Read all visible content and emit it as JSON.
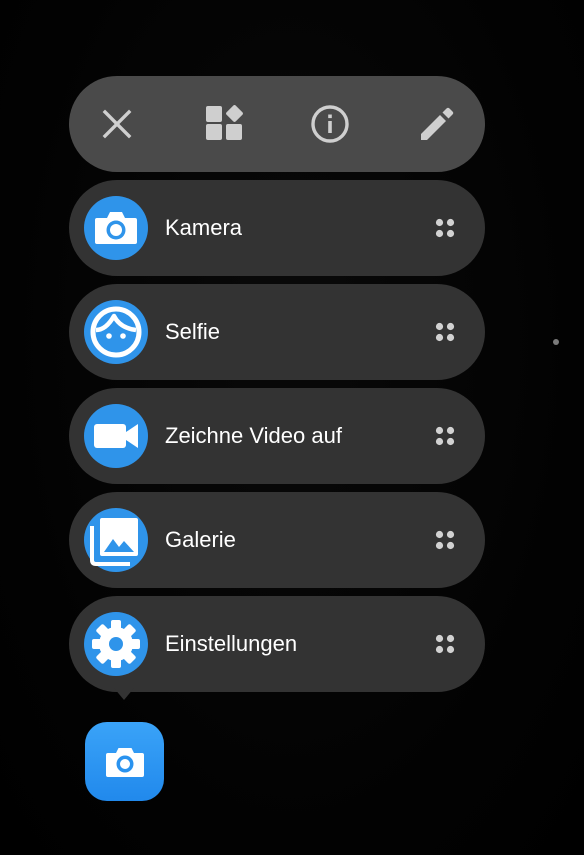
{
  "toolbar": {
    "buttons": [
      {
        "icon": "close-icon"
      },
      {
        "icon": "widgets-icon"
      },
      {
        "icon": "info-icon"
      },
      {
        "icon": "edit-pencil-icon"
      }
    ]
  },
  "shortcuts": [
    {
      "label": "Kamera",
      "icon": "camera-icon"
    },
    {
      "label": "Selfie",
      "icon": "selfie-face-icon"
    },
    {
      "label": "Zeichne Video auf",
      "icon": "video-camera-icon"
    },
    {
      "label": "Galerie",
      "icon": "gallery-icon"
    },
    {
      "label": "Einstellungen",
      "icon": "settings-gear-icon"
    }
  ],
  "home_icon": {
    "icon": "camera-app-icon"
  },
  "colors": {
    "accent": "#2f94ea",
    "toolbar_bg": "#4a4a4a",
    "item_bg": "#333333",
    "icon_gray": "#cfcfcf"
  }
}
